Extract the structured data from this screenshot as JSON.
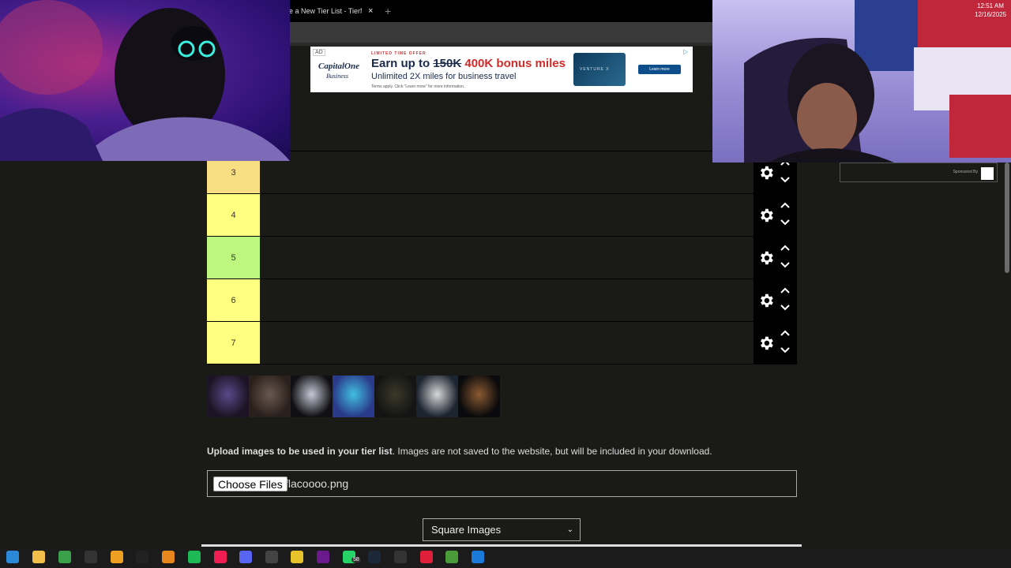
{
  "browser": {
    "tab_title": "e a New Tier List - TierMak",
    "tab_close": "×",
    "new_tab": "+"
  },
  "ad": {
    "label": "AD",
    "brand": "CapitalOne",
    "brand_sub": "Business",
    "offer_tag": "LIMITED TIME OFFER",
    "headline_prefix": "Earn up to ",
    "headline_old": "150K",
    "headline_new": "400K bonus miles",
    "subline": "Unlimited 2X miles for business travel",
    "terms": "Terms apply. Click \"Learn more\" for more information.",
    "card_text": "VENTURE X",
    "cta": "Learn more",
    "choice_icon": "▷"
  },
  "tiers": [
    {
      "label": "3",
      "color": "#f8df84"
    },
    {
      "label": "4",
      "color": "#ffff80"
    },
    {
      "label": "5",
      "color": "#bdf77f"
    },
    {
      "label": "6",
      "color": "#ffff80"
    },
    {
      "label": "7",
      "color": "#ffff80"
    }
  ],
  "images_tray": {
    "count": 7
  },
  "upload": {
    "bold": "Upload images to be used in your tier list",
    "rest": ". Images are not saved to the website, but will be included in your download.",
    "choose_button": "Choose Files",
    "file_name": "flacoooo.png"
  },
  "shape_select": {
    "selected": "Square Images"
  },
  "side_ad": {
    "sponsored": "Sponsored By"
  },
  "taskbar": {
    "badge": "58",
    "time": "12:51 AM",
    "date": "12/16/2025"
  }
}
